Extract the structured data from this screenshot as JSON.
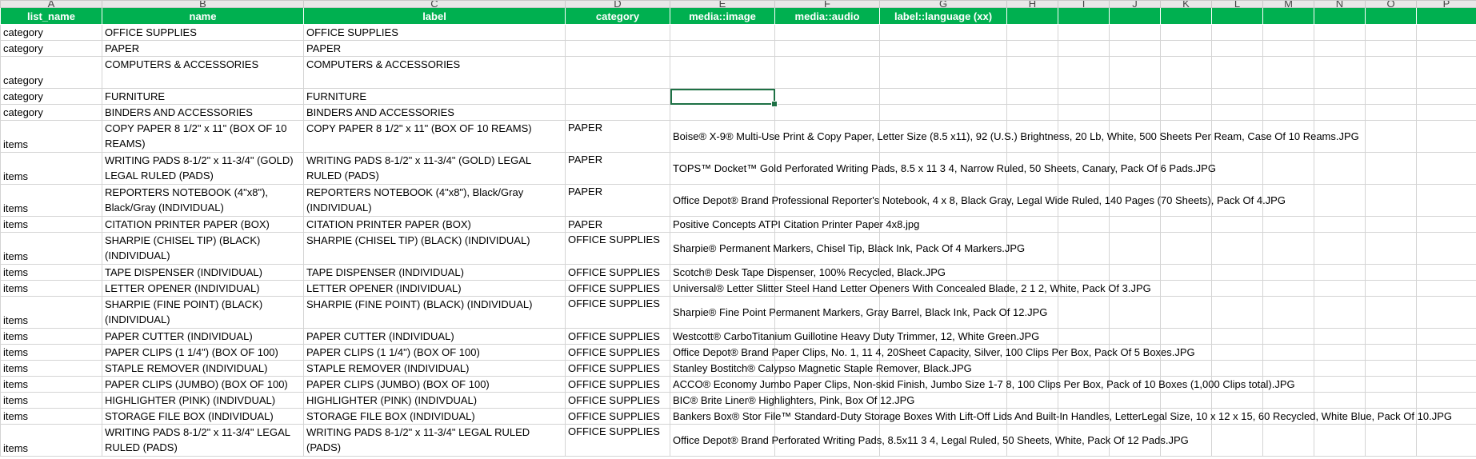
{
  "column_letters": [
    "A",
    "B",
    "C",
    "D",
    "E",
    "F",
    "G",
    "H",
    "I",
    "J",
    "K",
    "L",
    "M",
    "N",
    "O",
    "P"
  ],
  "header": [
    "list_name",
    "name",
    "label",
    "category",
    "media::image",
    "media::audio",
    "label::language (xx)"
  ],
  "rows": [
    {
      "list_name": "category",
      "name": "OFFICE SUPPLIES",
      "label": "OFFICE SUPPLIES",
      "category": "",
      "image": ""
    },
    {
      "list_name": "category",
      "name": "PAPER",
      "label": "PAPER",
      "category": "",
      "image": ""
    },
    {
      "list_name": "category",
      "name": "COMPUTERS & ACCESSORIES",
      "label": "COMPUTERS & ACCESSORIES",
      "category": "",
      "image": ""
    },
    {
      "list_name": "category",
      "name": "FURNITURE",
      "label": "FURNITURE",
      "category": "",
      "image": ""
    },
    {
      "list_name": "category",
      "name": "BINDERS AND ACCESSORIES",
      "label": "BINDERS AND ACCESSORIES",
      "category": "",
      "image": ""
    },
    {
      "list_name": "items",
      "name": "COPY PAPER 8 1/2\" x 11\" (BOX OF 10 REAMS)",
      "label": "COPY PAPER 8 1/2\" x 11\" (BOX OF 10 REAMS)",
      "category": "PAPER",
      "image": "Boise® X-9® Multi-Use Print & Copy Paper, Letter Size (8.5 x11), 92 (U.S.) Brightness, 20 Lb, White, 500 Sheets Per Ream, Case Of 10 Reams.JPG"
    },
    {
      "list_name": "items",
      "name": "WRITING PADS 8-1/2\" x 11-3/4\" (GOLD) LEGAL RULED (PADS)",
      "label": "WRITING PADS 8-1/2\" x 11-3/4\" (GOLD) LEGAL RULED (PADS)",
      "category": "PAPER",
      "image": "TOPS™ Docket™ Gold Perforated Writing Pads, 8.5 x 11 3 4, Narrow Ruled, 50 Sheets, Canary, Pack Of 6 Pads.JPG"
    },
    {
      "list_name": "items",
      "name": "REPORTERS NOTEBOOK (4\"x8\"), Black/Gray (INDIVIDUAL)",
      "label": "REPORTERS NOTEBOOK (4\"x8\"), Black/Gray (INDIVIDUAL)",
      "category": "PAPER",
      "image": "Office Depot® Brand Professional Reporter's Notebook, 4 x 8, Black Gray, Legal Wide Ruled, 140 Pages (70 Sheets), Pack Of 4.JPG"
    },
    {
      "list_name": "items",
      "name": "CITATION PRINTER PAPER (BOX)",
      "label": "CITATION PRINTER PAPER (BOX)",
      "category": "PAPER",
      "image": "Positive Concepts ATPI Citation Printer Paper 4x8.jpg"
    },
    {
      "list_name": "items",
      "name": "SHARPIE (CHISEL TIP) (BLACK) (INDIVIDUAL)",
      "label": "SHARPIE (CHISEL TIP) (BLACK)  (INDIVIDUAL)",
      "category": "OFFICE SUPPLIES",
      "image": "Sharpie® Permanent Markers, Chisel Tip, Black Ink, Pack Of 4 Markers.JPG"
    },
    {
      "list_name": "items",
      "name": "TAPE DISPENSER (INDIVIDUAL)",
      "label": "TAPE DISPENSER (INDIVIDUAL)",
      "category": "OFFICE SUPPLIES",
      "image": "Scotch® Desk Tape Dispenser, 100% Recycled, Black.JPG"
    },
    {
      "list_name": "items",
      "name": "LETTER OPENER (INDIVIDUAL)",
      "label": "LETTER OPENER (INDIVIDUAL)",
      "category": "OFFICE SUPPLIES",
      "image": "Universal® Letter Slitter Steel Hand Letter Openers With Concealed Blade, 2 1 2, White, Pack Of 3.JPG"
    },
    {
      "list_name": "items",
      "name": "SHARPIE (FINE POINT) (BLACK) (INDIVIDUAL)",
      "label": "SHARPIE (FINE POINT) (BLACK) (INDIVIDUAL)",
      "category": "OFFICE SUPPLIES",
      "image": "Sharpie® Fine Point Permanent Markers, Gray Barrel, Black Ink, Pack Of 12.JPG"
    },
    {
      "list_name": "items",
      "name": "PAPER CUTTER (INDIVIDUAL)",
      "label": "PAPER CUTTER (INDIVIDUAL)",
      "category": "OFFICE SUPPLIES",
      "image": "Westcott® CarboTitanium Guillotine Heavy Duty Trimmer, 12, White Green.JPG"
    },
    {
      "list_name": "items",
      "name": "PAPER CLIPS (1 1/4\") (BOX OF 100)",
      "label": "PAPER CLIPS (1 1/4\") (BOX OF 100)",
      "category": "OFFICE SUPPLIES",
      "image": "Office Depot® Brand Paper Clips, No. 1, 11 4, 20Sheet Capacity, Silver, 100 Clips Per Box, Pack Of 5 Boxes.JPG"
    },
    {
      "list_name": "items",
      "name": "STAPLE REMOVER (INDIVIDUAL)",
      "label": "STAPLE REMOVER (INDIVIDUAL)",
      "category": "OFFICE SUPPLIES",
      "image": "Stanley Bostitch® Calypso Magnetic Staple Remover, Black.JPG"
    },
    {
      "list_name": "items",
      "name": "PAPER CLIPS (JUMBO) (BOX OF 100)",
      "label": "PAPER CLIPS (JUMBO) (BOX OF 100)",
      "category": "OFFICE SUPPLIES",
      "image": "ACCO® Economy Jumbo Paper Clips, Non-skid Finish, Jumbo Size 1-7 8, 100 Clips Per Box, Pack of 10 Boxes (1,000 Clips total).JPG"
    },
    {
      "list_name": "items",
      "name": "HIGHLIGHTER (PINK) (INDIVDUAL)",
      "label": "HIGHLIGHTER (PINK) (INDIVDUAL)",
      "category": "OFFICE SUPPLIES",
      "image": "BIC® Brite Liner® Highlighters, Pink, Box Of 12.JPG"
    },
    {
      "list_name": "items",
      "name": "STORAGE FILE BOX (INDIVIDUAL)",
      "label": "STORAGE FILE BOX (INDIVIDUAL)",
      "category": "OFFICE SUPPLIES",
      "image": "Bankers Box® Stor File™ Standard-Duty Storage Boxes With Lift-Off Lids And Built-In Handles, LetterLegal Size, 10 x 12 x 15, 60 Recycled, White Blue, Pack Of 10.JPG"
    },
    {
      "list_name": "items",
      "name": "WRITING PADS 8-1/2\" x 11-3/4\" LEGAL RULED (PADS)",
      "label": "WRITING PADS 8-1/2\" x 11-3/4\" LEGAL RULED (PADS)",
      "category": "OFFICE SUPPLIES",
      "image": "Office Depot® Brand Perforated Writing Pads, 8.5x11 3 4, Legal Ruled, 50 Sheets, White, Pack Of 12 Pads.JPG"
    }
  ],
  "selected_cell": "E4",
  "colors": {
    "header_bg": "#00b050",
    "header_text": "#ffffff",
    "grid": "#d4d4d4",
    "selection": "#1e7145"
  }
}
